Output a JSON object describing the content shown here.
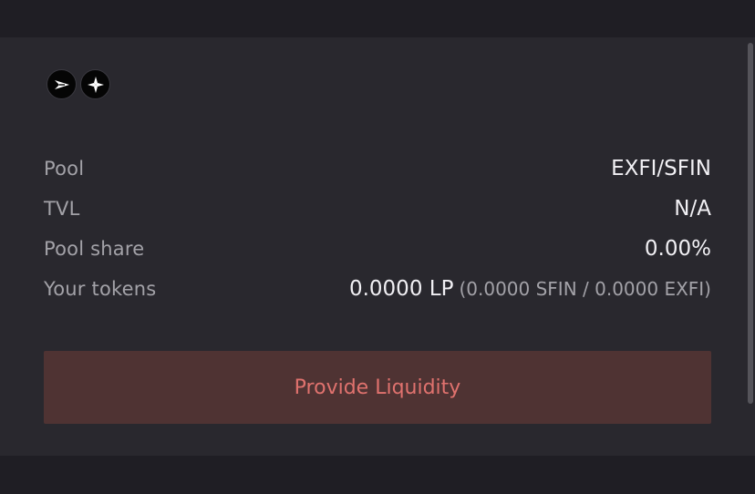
{
  "pool": {
    "icons": [
      "exfi-token-icon",
      "sfin-token-icon"
    ],
    "rows": [
      {
        "label": "Pool",
        "value": "EXFI/SFIN",
        "sub": ""
      },
      {
        "label": "TVL",
        "value": "N/A",
        "sub": ""
      },
      {
        "label": "Pool share",
        "value": "0.00%",
        "sub": ""
      },
      {
        "label": "Your tokens",
        "value": "0.0000 LP",
        "sub": "(0.0000 SFIN / 0.0000 EXFI)"
      }
    ]
  },
  "actions": {
    "provide_label": "Provide Liquidity"
  },
  "colors": {
    "page_bg": "#1f1e24",
    "card_bg": "#29282e",
    "label": "#a3a2a8",
    "value": "#f1f0f4",
    "button_bg": "#4f3333",
    "button_text": "#e0726e"
  }
}
